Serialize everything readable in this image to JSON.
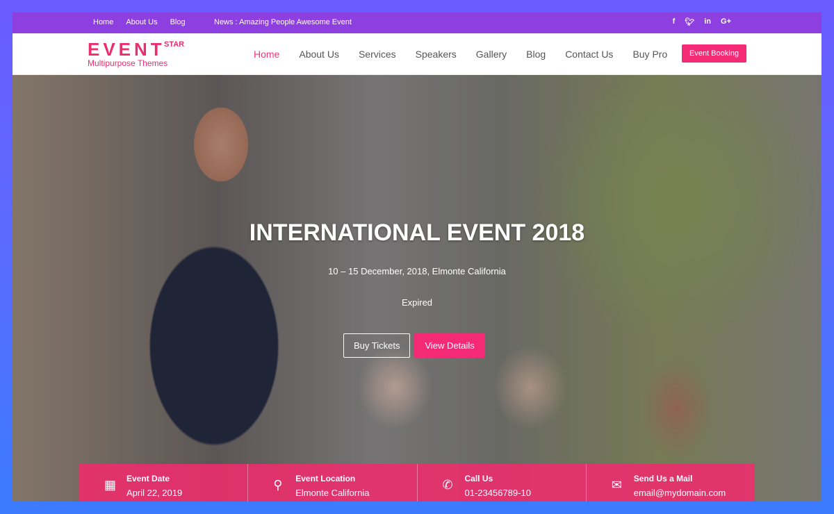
{
  "topbar": {
    "links": [
      "Home",
      "About Us",
      "Blog"
    ],
    "news": "News : Amazing People Awesome Event",
    "social": [
      "f",
      "t",
      "in",
      "G+"
    ]
  },
  "logo": {
    "word": "EVENT",
    "star": "STAR",
    "sub": "Multipurpose Themes"
  },
  "menu": [
    "Home",
    "About Us",
    "Services",
    "Speakers",
    "Gallery",
    "Blog",
    "Contact Us",
    "Buy Pro"
  ],
  "booking": "Event Booking",
  "hero": {
    "title": "INTERNATIONAL EVENT 2018",
    "date": "10 – 15 December, 2018, Elmonte California",
    "status": "Expired",
    "buy": "Buy Tickets",
    "view": "View Details"
  },
  "info": [
    {
      "icon": "calendar-icon",
      "title": "Event Date",
      "value": "April 22, 2019"
    },
    {
      "icon": "location-pin-icon",
      "title": "Event Location",
      "value": "Elmonte California"
    },
    {
      "icon": "phone-icon",
      "title": "Call Us",
      "value": "01-23456789-10"
    },
    {
      "icon": "mail-icon",
      "title": "Send Us a Mail",
      "value": "email@mydomain.com"
    }
  ],
  "colors": {
    "accent": "#ec2d6e",
    "topbar": "#8d3fe0"
  }
}
